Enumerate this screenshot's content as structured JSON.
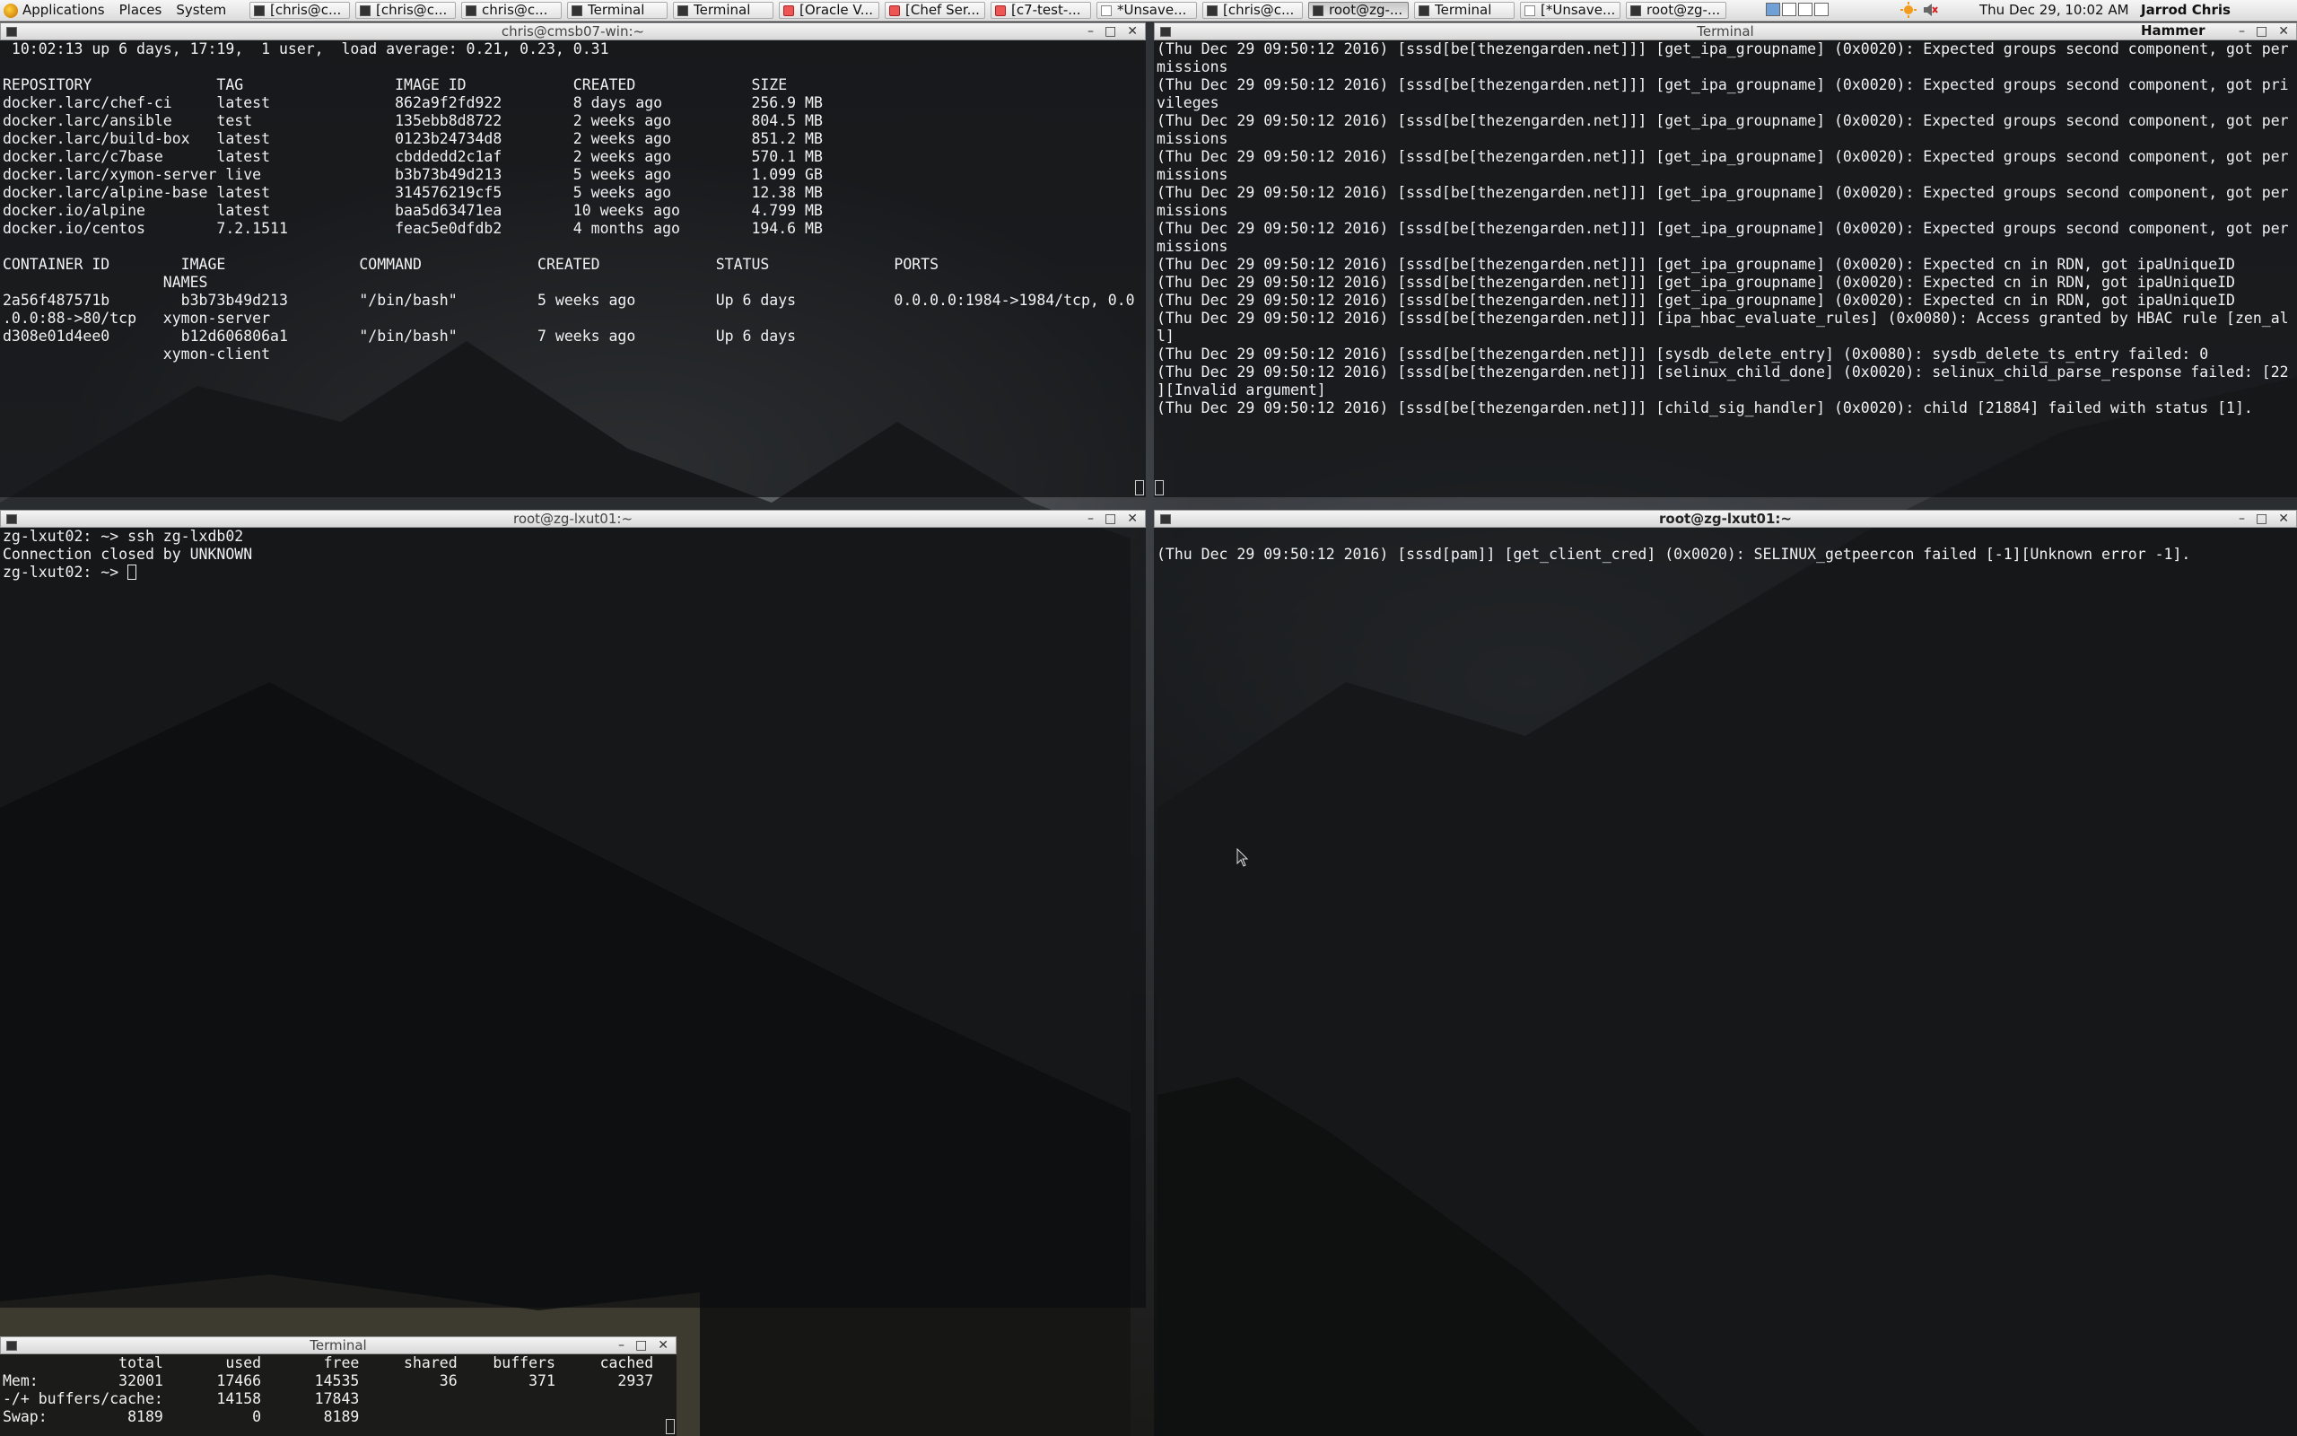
{
  "panel": {
    "menu": [
      "Applications",
      "Places",
      "System"
    ],
    "tasks": [
      {
        "label": "[chris@c...",
        "icon": "terminal-icon"
      },
      {
        "label": "[chris@c...",
        "icon": "terminal-icon"
      },
      {
        "label": "chris@c...",
        "icon": "terminal-icon"
      },
      {
        "label": "Terminal",
        "icon": "terminal-icon"
      },
      {
        "label": "Terminal",
        "icon": "terminal-icon"
      },
      {
        "label": "[Oracle V...",
        "icon": "browser-icon"
      },
      {
        "label": "[Chef Ser...",
        "icon": "browser-icon"
      },
      {
        "label": "[c7-test-...",
        "icon": "browser-icon"
      },
      {
        "label": "*Unsave...",
        "icon": "editor-icon"
      },
      {
        "label": "[chris@c...",
        "icon": "terminal-icon"
      },
      {
        "label": "root@zg-...",
        "icon": "terminal-icon"
      },
      {
        "label": "Terminal",
        "icon": "terminal-icon"
      },
      {
        "label": "[*Unsave...",
        "icon": "editor-icon"
      },
      {
        "label": "root@zg-...",
        "icon": "terminal-icon"
      }
    ],
    "clock": "Thu Dec 29, 10:02 AM",
    "user": "Jarrod Chris Hammer"
  },
  "windows": {
    "docker": {
      "title": "chris@cmsb07-win:~",
      "lines": [
        " 10:02:13 up 6 days, 17:19,  1 user,  load average: 0.21, 0.23, 0.31",
        "",
        "REPOSITORY              TAG                 IMAGE ID            CREATED             SIZE",
        "docker.larc/chef-ci     latest              862a9f2fd922        8 days ago          256.9 MB",
        "docker.larc/ansible     test                135ebb8d8722        2 weeks ago         804.5 MB",
        "docker.larc/build-box   latest              0123b24734d8        2 weeks ago         851.2 MB",
        "docker.larc/c7base      latest              cbddedd2c1af        2 weeks ago         570.1 MB",
        "docker.larc/xymon-server live               b3b73b49d213        5 weeks ago         1.099 GB",
        "docker.larc/alpine-base latest              314576219cf5        5 weeks ago         12.38 MB",
        "docker.io/alpine        latest              baa5d63471ea        10 weeks ago        4.799 MB",
        "docker.io/centos        7.2.1511            feac5e0dfdb2        4 months ago        194.6 MB",
        "",
        "CONTAINER ID        IMAGE               COMMAND             CREATED             STATUS              PORTS",
        "                  NAMES",
        "2a56f487571b        b3b73b49d213        \"/bin/bash\"         5 weeks ago         Up 6 days           0.0.0.0:1984->1984/tcp, 0.0",
        ".0.0:88->80/tcp   xymon-server",
        "d308e01d4ee0        b12d606806a1        \"/bin/bash\"         7 weeks ago         Up 6 days",
        "                  xymon-client"
      ]
    },
    "sssd_log": {
      "title": "Terminal",
      "lines": [
        "(Thu Dec 29 09:50:12 2016) [sssd[be[thezengarden.net]]] [get_ipa_groupname] (0x0020): Expected groups second component, got per",
        "missions",
        "(Thu Dec 29 09:50:12 2016) [sssd[be[thezengarden.net]]] [get_ipa_groupname] (0x0020): Expected groups second component, got pri",
        "vileges",
        "(Thu Dec 29 09:50:12 2016) [sssd[be[thezengarden.net]]] [get_ipa_groupname] (0x0020): Expected groups second component, got per",
        "missions",
        "(Thu Dec 29 09:50:12 2016) [sssd[be[thezengarden.net]]] [get_ipa_groupname] (0x0020): Expected groups second component, got per",
        "missions",
        "(Thu Dec 29 09:50:12 2016) [sssd[be[thezengarden.net]]] [get_ipa_groupname] (0x0020): Expected groups second component, got per",
        "missions",
        "(Thu Dec 29 09:50:12 2016) [sssd[be[thezengarden.net]]] [get_ipa_groupname] (0x0020): Expected groups second component, got per",
        "missions",
        "(Thu Dec 29 09:50:12 2016) [sssd[be[thezengarden.net]]] [get_ipa_groupname] (0x0020): Expected cn in RDN, got ipaUniqueID",
        "(Thu Dec 29 09:50:12 2016) [sssd[be[thezengarden.net]]] [get_ipa_groupname] (0x0020): Expected cn in RDN, got ipaUniqueID",
        "(Thu Dec 29 09:50:12 2016) [sssd[be[thezengarden.net]]] [get_ipa_groupname] (0x0020): Expected cn in RDN, got ipaUniqueID",
        "(Thu Dec 29 09:50:12 2016) [sssd[be[thezengarden.net]]] [ipa_hbac_evaluate_rules] (0x0080): Access granted by HBAC rule [zen_al",
        "l]",
        "(Thu Dec 29 09:50:12 2016) [sssd[be[thezengarden.net]]] [sysdb_delete_entry] (0x0080): sysdb_delete_ts_entry failed: 0",
        "(Thu Dec 29 09:50:12 2016) [sssd[be[thezengarden.net]]] [selinux_child_done] (0x0020): selinux_child_parse_response failed: [22",
        "][Invalid argument]",
        "(Thu Dec 29 09:50:12 2016) [sssd[be[thezengarden.net]]] [child_sig_handler] (0x0020): child [21884] failed with status [1]."
      ]
    },
    "ssh": {
      "title": "root@zg-lxut01:~",
      "lines": [
        "zg-lxut02: ~> ssh zg-lxdb02",
        "Connection closed by UNKNOWN"
      ],
      "prompt": "zg-lxut02: ~> "
    },
    "pam_log": {
      "title": "root@zg-lxut01:~",
      "lines": [
        "",
        "(Thu Dec 29 09:50:12 2016) [sssd[pam]] [get_client_cred] (0x0020): SELINUX_getpeercon failed [-1][Unknown error -1]."
      ]
    },
    "free": {
      "title": "Terminal",
      "lines": [
        "             total       used       free     shared    buffers     cached",
        "Mem:         32001      17466      14535         36        371       2937",
        "-/+ buffers/cache:      14158      17843",
        "Swap:         8189          0       8189"
      ]
    }
  }
}
